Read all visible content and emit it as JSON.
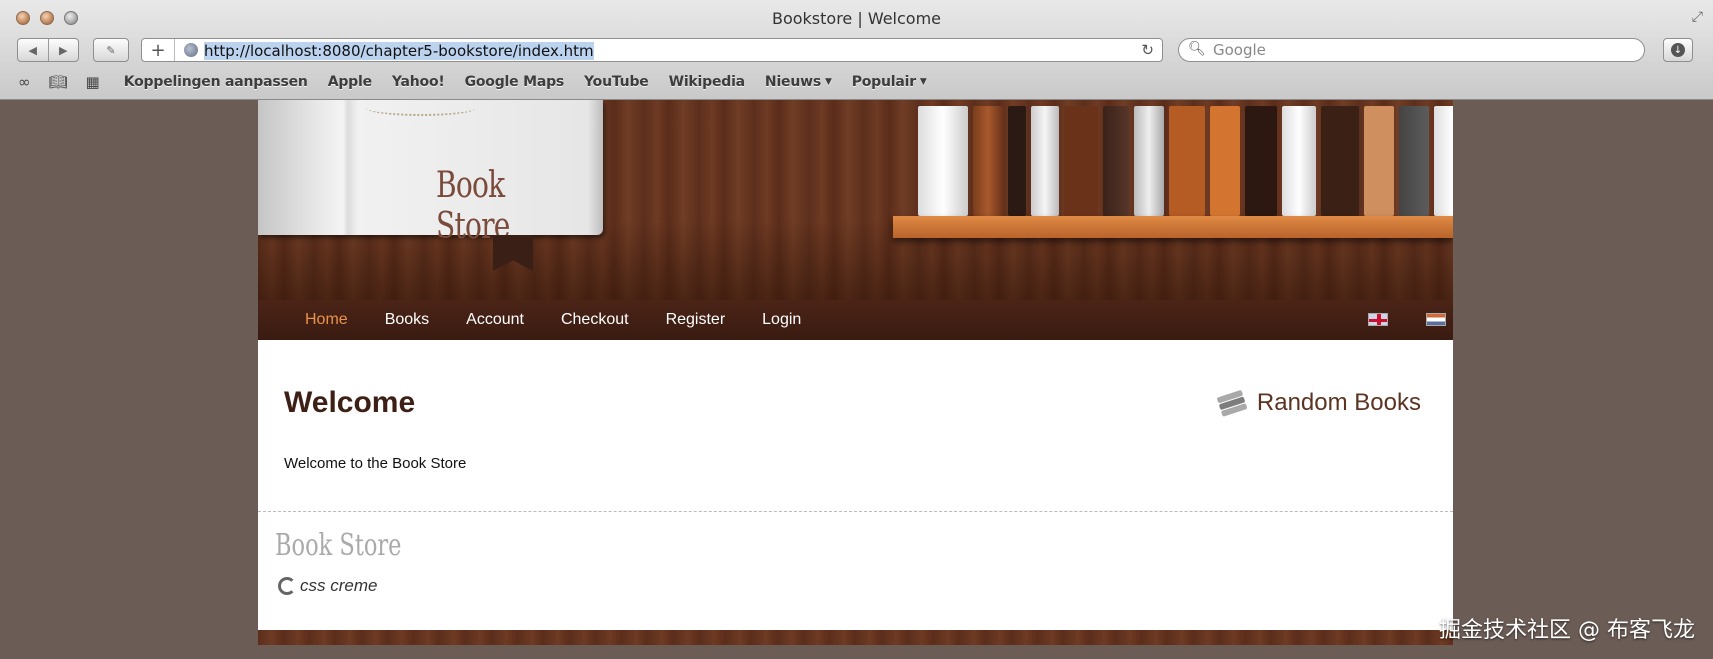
{
  "window": {
    "title": "Bookstore | Welcome"
  },
  "toolbar": {
    "back_icon": "◀",
    "forward_icon": "▶",
    "url": "http://localhost:8080/chapter5-bookstore/index.htm",
    "search_placeholder": "Google"
  },
  "bookmarks": {
    "items": [
      {
        "label": "Koppelingen aanpassen"
      },
      {
        "label": "Apple"
      },
      {
        "label": "Yahoo!"
      },
      {
        "label": "Google Maps"
      },
      {
        "label": "YouTube"
      },
      {
        "label": "Wikipedia"
      },
      {
        "label": "Nieuws",
        "dropdown": true
      },
      {
        "label": "Populair",
        "dropdown": true
      }
    ]
  },
  "site": {
    "logo_text": "Book Store",
    "nav": [
      "Home",
      "Books",
      "Account",
      "Checkout",
      "Register",
      "Login"
    ],
    "active_nav": "Home",
    "accent_color": "#e8924a",
    "brand_color": "#3d1f15",
    "flags": [
      "uk-flag-icon",
      "nl-flag-icon"
    ]
  },
  "content": {
    "title": "Welcome",
    "text": "Welcome to the Book Store",
    "sidebar_title": "Random Books"
  },
  "footer": {
    "logo_text": "Book Store",
    "credit": "css creme"
  },
  "watermark": "掘金技术社区 @ 布客飞龙"
}
